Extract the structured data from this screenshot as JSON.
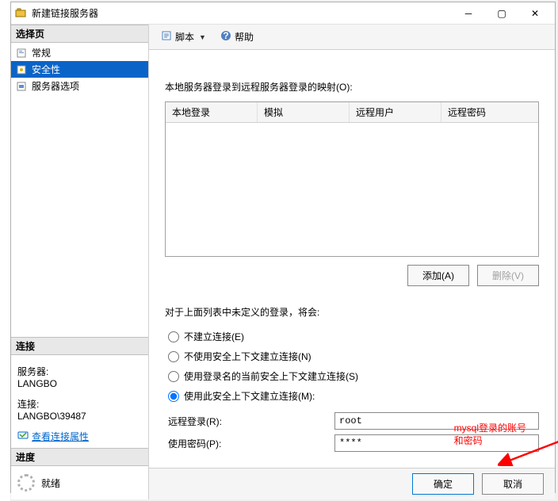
{
  "window": {
    "title": "新建链接服务器"
  },
  "sidebar": {
    "pages_header": "选择页",
    "pages": [
      {
        "label": "常规",
        "selected": false
      },
      {
        "label": "安全性",
        "selected": true
      },
      {
        "label": "服务器选项",
        "selected": false
      }
    ],
    "connection_header": "连接",
    "server_label": "服务器:",
    "server_value": "LANGBO",
    "connection_label": "连接:",
    "connection_value": "LANGBO\\39487",
    "view_props": "查看连接属性",
    "progress_header": "进度",
    "progress_status": "就绪"
  },
  "toolbar": {
    "script": "脚本",
    "help": "帮助"
  },
  "main": {
    "mapping_label": "本地服务器登录到远程服务器登录的映射(O):",
    "columns": {
      "local_login": "本地登录",
      "impersonate": "模拟",
      "remote_user": "远程用户",
      "remote_password": "远程密码"
    },
    "add_btn": "添加(A)",
    "remove_btn": "删除(V)",
    "undefined_label": "对于上面列表中未定义的登录，将会:",
    "radios": {
      "not_made": "不建立连接(E)",
      "without_security": "不使用安全上下文建立连接(N)",
      "current_security": "使用登录名的当前安全上下文建立连接(S)",
      "this_security": "使用此安全上下文建立连接(M):"
    },
    "selected_radio": "this_security",
    "remote_login_label": "远程登录(R):",
    "remote_login_value": "root",
    "password_label": "使用密码(P):",
    "password_value": "****"
  },
  "footer": {
    "ok": "确定",
    "cancel": "取消"
  },
  "annotation": {
    "line1": "mysql登录的账号",
    "line2": "和密码"
  }
}
